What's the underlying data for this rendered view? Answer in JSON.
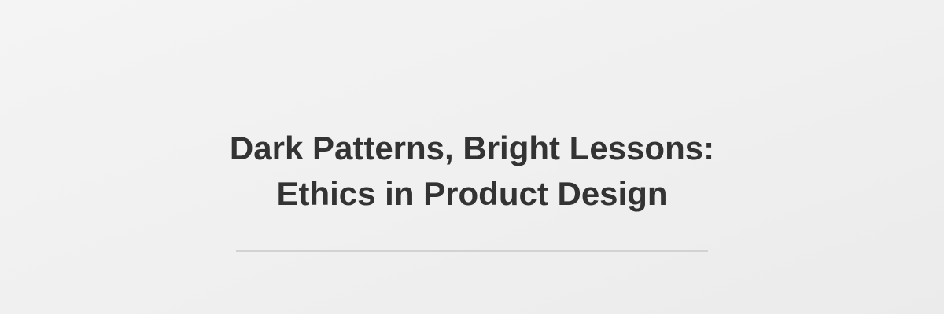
{
  "hero": {
    "title_line_1": "Dark Patterns, Bright Lessons:",
    "title_line_2": "Ethics in Product Design"
  },
  "colors": {
    "background": "#f0f0f0",
    "title_text": "#333333",
    "divider": "#d2d2d2"
  }
}
